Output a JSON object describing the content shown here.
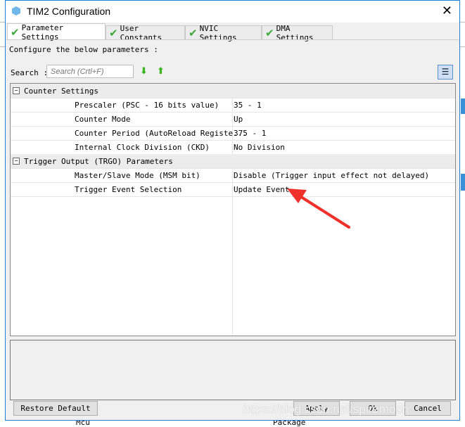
{
  "window": {
    "title": "TIM2 Configuration",
    "close": "✕"
  },
  "tabs": [
    {
      "label": "Parameter Settings",
      "active": true
    },
    {
      "label": "User Constants"
    },
    {
      "label": "NVIC Settings"
    },
    {
      "label": "DMA Settings"
    }
  ],
  "config_label": "Configure the below parameters :",
  "search": {
    "label": "Search :",
    "placeholder": "Search (Crtl+F)"
  },
  "groups": [
    {
      "title": "Counter Settings",
      "rows": [
        {
          "name": "Prescaler (PSC - 16 bits value)",
          "value": "35 - 1"
        },
        {
          "name": "Counter Mode",
          "value": "Up"
        },
        {
          "name": "Counter Period (AutoReload Registe...",
          "value": "375 - 1"
        },
        {
          "name": "Internal Clock Division (CKD)",
          "value": "No Division"
        }
      ]
    },
    {
      "title": "Trigger Output (TRGO) Parameters",
      "rows": [
        {
          "name": "Master/Slave Mode (MSM bit)",
          "value": "Disable (Trigger input effect not delayed)"
        },
        {
          "name": "Trigger Event Selection",
          "value": "Update Event"
        }
      ]
    }
  ],
  "buttons": {
    "restore": "Restore Default",
    "apply": "Apply",
    "ok": "Ok",
    "cancel": "Cancel"
  },
  "background": {
    "col1": "Mcu",
    "col2": "Package"
  },
  "watermark": "https://blog.csdn.net/spiremoon",
  "colors": {
    "accent": "#1e7fd6",
    "check": "#3ca83c",
    "annotation_arrow": "#f0302a"
  }
}
